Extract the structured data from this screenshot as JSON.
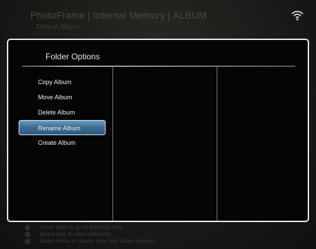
{
  "header": {
    "title": "PhotoFrame | Internal Memory | ALBUM",
    "subtitle": "Default Album",
    "wifi_icon": "wifi-icon"
  },
  "dialog": {
    "title": "Folder Options",
    "items": [
      {
        "label": "Copy Album"
      },
      {
        "label": "Move Album"
      },
      {
        "label": "Delete Album"
      },
      {
        "label": "Rename Album",
        "selected": true
      },
      {
        "label": "Create Album"
      }
    ],
    "selected_index": 3,
    "accent_color": "#3e6e92"
  },
  "hints": [
    {
      "icon": "back-button-icon",
      "text": "Select back to go to previous view"
    },
    {
      "icon": "play-button-icon",
      "text": "Select play to view slideshow"
    },
    {
      "icon": "menu-button-icon",
      "text": "Select menu to create, copy and delete photos"
    }
  ]
}
